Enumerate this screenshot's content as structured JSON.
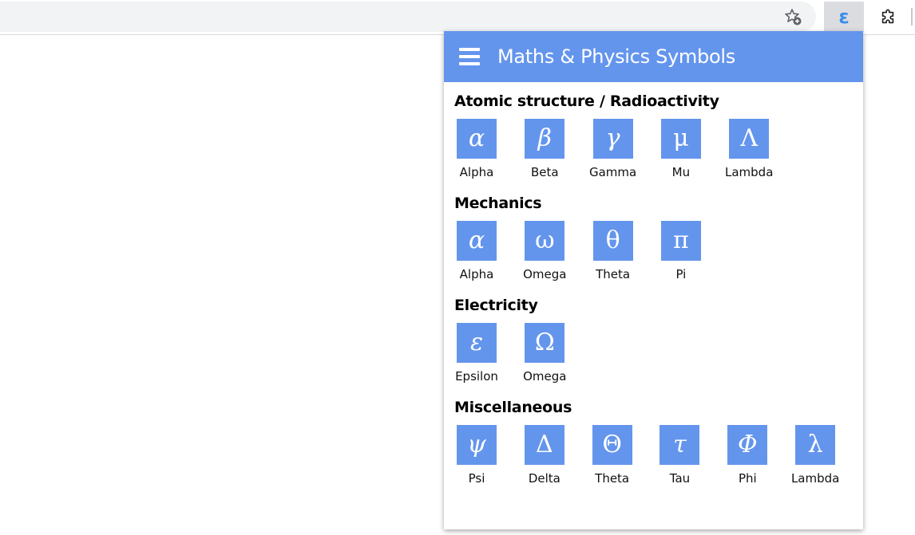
{
  "popup": {
    "title": "Maths & Physics Symbols",
    "header_color": "#6495ed",
    "sections": [
      {
        "title": "Atomic structure / Radioactivity",
        "symbols": [
          {
            "glyph": "α",
            "label": "Alpha"
          },
          {
            "glyph": "β",
            "label": "Beta"
          },
          {
            "glyph": "γ",
            "label": "Gamma"
          },
          {
            "glyph": "μ",
            "label": "Mu"
          },
          {
            "glyph": "Λ",
            "label": "Lambda"
          }
        ]
      },
      {
        "title": "Mechanics",
        "symbols": [
          {
            "glyph": "α",
            "label": "Alpha"
          },
          {
            "glyph": "ω",
            "label": "Omega"
          },
          {
            "glyph": "θ",
            "label": "Theta"
          },
          {
            "glyph": "π",
            "label": "Pi"
          }
        ]
      },
      {
        "title": "Electricity",
        "symbols": [
          {
            "glyph": "ε",
            "label": "Epsilon"
          },
          {
            "glyph": "Ω",
            "label": "Omega"
          }
        ]
      },
      {
        "title": "Miscellaneous",
        "symbols": [
          {
            "glyph": "ψ",
            "label": "Psi"
          },
          {
            "glyph": "Δ",
            "label": "Delta"
          },
          {
            "glyph": "Θ",
            "label": "Theta"
          },
          {
            "glyph": "τ",
            "label": "Tau"
          },
          {
            "glyph": "Φ",
            "label": "Phi"
          },
          {
            "glyph": "λ",
            "label": "Lambda"
          }
        ]
      }
    ]
  },
  "toolbar": {
    "extension_glyph": "ε",
    "icons": [
      "bookmark-star-icon",
      "extension-epsilon-icon",
      "extensions-puzzle-icon"
    ]
  }
}
